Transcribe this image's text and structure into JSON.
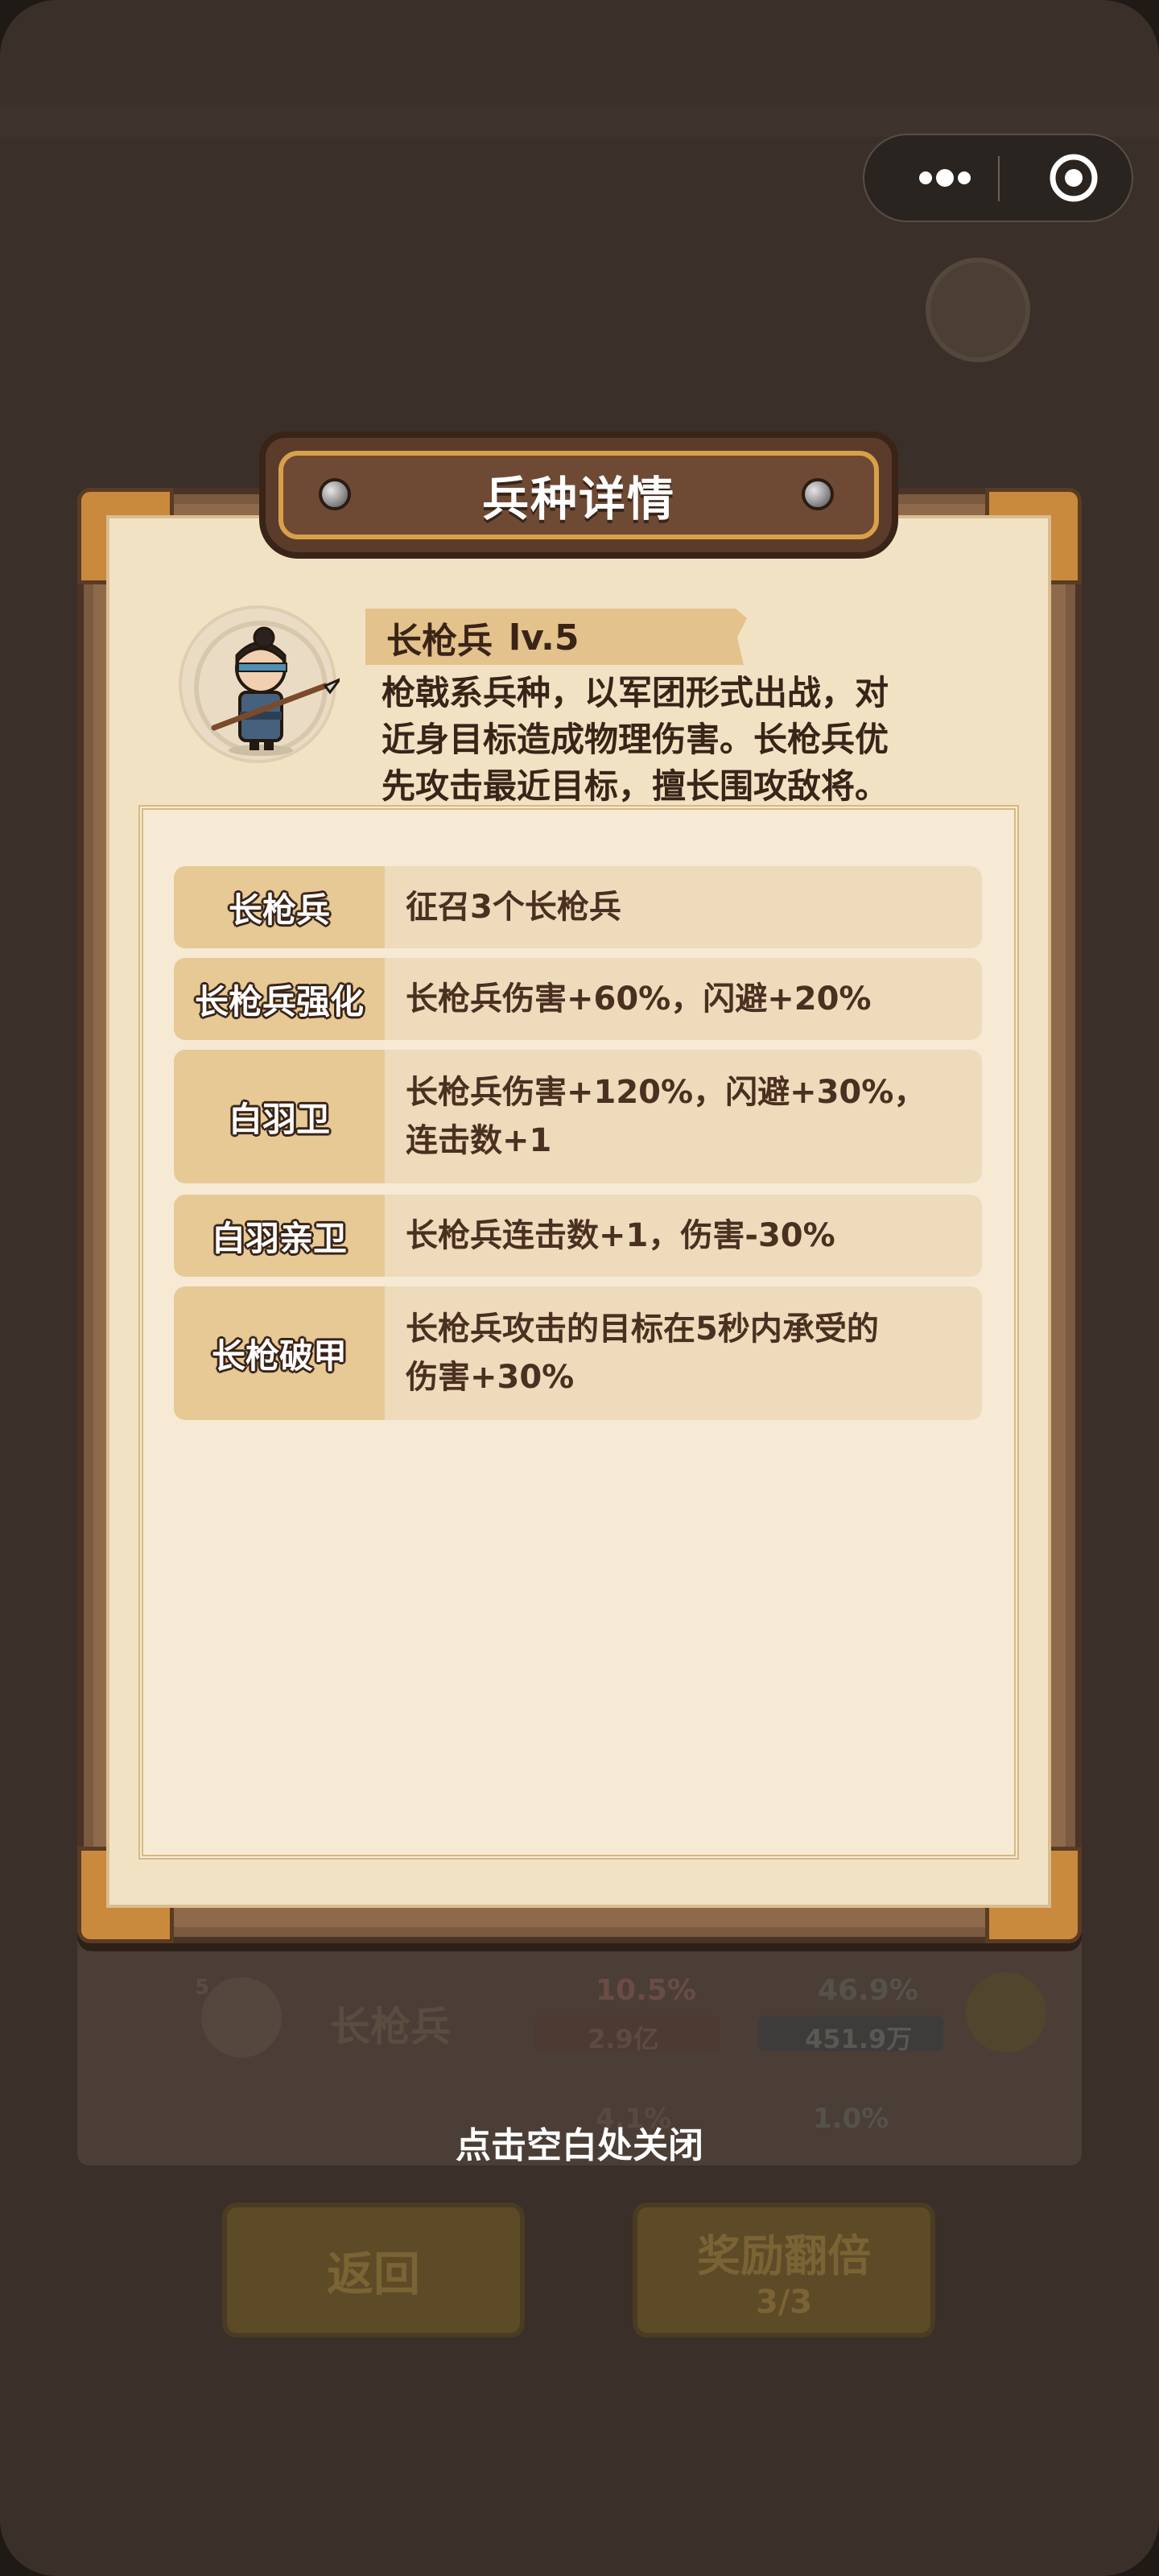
{
  "capsule": {
    "more_icon": "more-dots-icon",
    "close_icon": "target-close-icon"
  },
  "modal": {
    "title": "兵种详情",
    "unit": {
      "name": "长枪兵",
      "level": "lv.5",
      "description_lines": [
        "枪戟系兵种，以军团形式出战，对",
        "近身目标造成物理伤害。长枪兵优",
        "先攻击最近目标，擅长围攻敌将。"
      ]
    },
    "upgrades": [
      {
        "label": "长枪兵",
        "lines": [
          "征召3个长枪兵"
        ]
      },
      {
        "label": "长枪兵强化",
        "lines": [
          "长枪兵伤害+60%，闪避+20%"
        ]
      },
      {
        "label": "白羽卫",
        "lines": [
          "长枪兵伤害+120%，闪避+30%，",
          "连击数+1"
        ]
      },
      {
        "label": "白羽亲卫",
        "lines": [
          "长枪兵连击数+1，伤害-30%"
        ]
      },
      {
        "label": "长枪破甲",
        "lines": [
          "长枪兵攻击的目标在5秒内承受的",
          "伤害+30%"
        ]
      }
    ]
  },
  "close_hint": "点击空白处关闭",
  "background": {
    "unit_level": "5",
    "unit_name": "长枪兵",
    "attack_percent": "10.5%",
    "attack_value": "2.9亿",
    "defense_percent": "46.9%",
    "defense_value": "451.9万",
    "next_attack_percent": "4.1%",
    "next_defense_percent": "1.0%",
    "back_button": "返回",
    "double_reward_button": "奖励翻倍",
    "double_reward_count": "3/3"
  },
  "colors": {
    "accent_gold": "#d9a04a",
    "wood_dark": "#5b3c2b",
    "parchment": "#f2e2c4",
    "label_tan": "#e7c995",
    "value_tan": "#eedbbc"
  }
}
